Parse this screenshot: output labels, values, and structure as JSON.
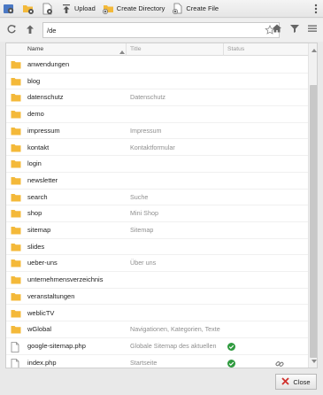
{
  "toolbar": {
    "upload_label": "Upload",
    "create_directory_label": "Create Directory",
    "create_file_label": "Create File"
  },
  "address": {
    "path": "/de"
  },
  "columns": {
    "name": "Name",
    "title": "Title",
    "status": "Status"
  },
  "files": [
    {
      "name": "anwendungen",
      "title": "",
      "type": "folder"
    },
    {
      "name": "blog",
      "title": "",
      "type": "folder"
    },
    {
      "name": "datenschutz",
      "title": "Datenschutz",
      "type": "folder"
    },
    {
      "name": "demo",
      "title": "",
      "type": "folder"
    },
    {
      "name": "impressum",
      "title": "Impressum",
      "type": "folder"
    },
    {
      "name": "kontakt",
      "title": "Kontaktformular",
      "type": "folder"
    },
    {
      "name": "login",
      "title": "",
      "type": "folder"
    },
    {
      "name": "newsletter",
      "title": "",
      "type": "folder"
    },
    {
      "name": "search",
      "title": "Suche",
      "type": "folder"
    },
    {
      "name": "shop",
      "title": "Mini Shop",
      "type": "folder"
    },
    {
      "name": "sitemap",
      "title": "Sitemap",
      "type": "folder"
    },
    {
      "name": "slides",
      "title": "",
      "type": "folder"
    },
    {
      "name": "ueber-uns",
      "title": "Über uns",
      "type": "folder"
    },
    {
      "name": "unternehmensverzeichnis",
      "title": "",
      "type": "folder"
    },
    {
      "name": "veranstaltungen",
      "title": "",
      "type": "folder"
    },
    {
      "name": "weblicTV",
      "title": "",
      "type": "folder"
    },
    {
      "name": "wGlobal",
      "title": "Navigationen, Kategorien, Texte",
      "type": "folder"
    },
    {
      "name": "google-sitemap.php",
      "title": "Globale Sitemap des aktuellen",
      "type": "file",
      "status": "ok"
    },
    {
      "name": "index.php",
      "title": "Startseite",
      "type": "file",
      "status": "ok",
      "linked": true
    }
  ],
  "footer": {
    "close_label": "Close"
  },
  "colors": {
    "folder": "#f3b93a",
    "status_ok": "#2e9a3e",
    "close_x": "#d0312d"
  },
  "icons": {
    "settings_1": "gear-blue-icon",
    "settings_2": "gear-folder-icon",
    "settings_3": "gear-file-icon",
    "upload": "upload-icon",
    "create_directory": "new-folder-icon",
    "create_file": "new-file-icon",
    "more": "vertical-dots-icon",
    "refresh": "refresh-icon",
    "up": "arrow-up-icon",
    "star": "star-icon",
    "home": "home-icon",
    "filter": "filter-icon",
    "list": "list-view-icon"
  }
}
